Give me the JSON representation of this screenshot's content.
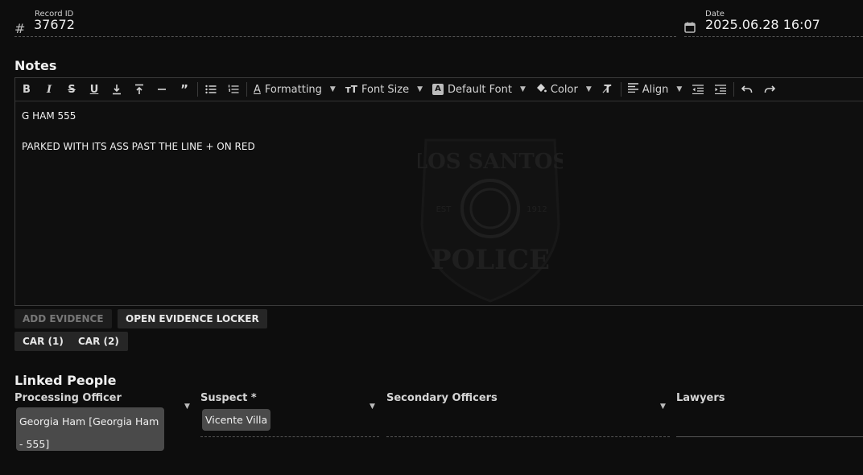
{
  "record": {
    "label": "Record ID",
    "value": "37672",
    "icon": "hash-icon"
  },
  "date": {
    "label": "Date",
    "value": "2025.06.28 16:07",
    "icon": "calendar-icon"
  },
  "notes": {
    "title": "Notes",
    "toolbar": {
      "formatting": "Formatting",
      "font_size": "Font Size",
      "default_font": "Default Font",
      "color": "Color",
      "align": "Align"
    },
    "lines": [
      "G HAM 555",
      "",
      "PARKED WITH ITS ASS PAST THE LINE + ON RED"
    ],
    "watermark": {
      "top": "LOS SANTOS",
      "bottom": "POLICE",
      "est": "EST",
      "year": "1912"
    }
  },
  "evidence": {
    "add_label": "ADD EVIDENCE",
    "locker_label": "OPEN EVIDENCE LOCKER",
    "items": [
      "CAR (1)",
      "CAR (2)"
    ]
  },
  "linked_people": {
    "title": "Linked People",
    "processing_officer": {
      "label": "Processing Officer",
      "value": "Georgia Ham [Georgia Ham - 555]"
    },
    "suspect": {
      "label": "Suspect *",
      "value": "Vicente Villa"
    },
    "secondary_officers": {
      "label": "Secondary Officers"
    },
    "lawyers": {
      "label": "Lawyers"
    }
  }
}
